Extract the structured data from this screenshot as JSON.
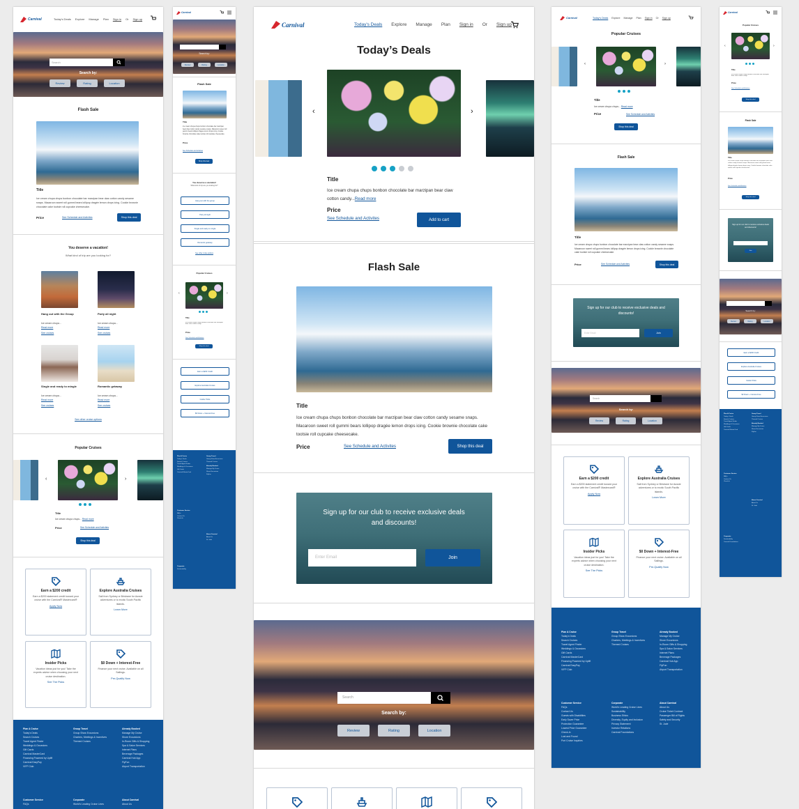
{
  "brand": {
    "logo_text": "Carnival",
    "accent_color": "#10559a",
    "footer_color": "#10559a",
    "dot_color": "#16a1c5"
  },
  "nav": {
    "todays_deals": "Today's Deals",
    "explore": "Explore",
    "manage": "Manage",
    "plan": "Plan",
    "sign_in": "Sign in",
    "or": "Or",
    "sign_up": "Sign up"
  },
  "main": {
    "todays_deals_title": "Today’s Deals",
    "flash_sale_title": "Flash Sale",
    "popular_cruises_title": "Popular Cruises",
    "item_title": "Title",
    "deal_desc_short": "Ice cream chupa chups bonbon chocolate bar marzipan bear claw cotton candy...",
    "deal_read_more": "Read more",
    "flash_desc": "Ice cream chupa chups bonbon chocolate bar marzipan bear claw cotton candy sesame snaps. Macaroon sweet roll gummi bears lollipop dragée lemon drops icing. Cookie brownie chocolate cake tootsie roll cupcake cheesecake.",
    "price_label": "Price",
    "schedule_link": "See Schedule and Activites",
    "add_to_cart": "Add to cart",
    "shop_this_deal": "Shop this deal",
    "signup_title": "Sign up for our club to receive exclusive deals and discounts!",
    "email_placeholder": "Enter Email",
    "join": "Join",
    "search_placeholder": "Search",
    "search_by": "Search by:",
    "filters": [
      "Review",
      "Rating",
      "Location"
    ]
  },
  "vacation": {
    "title": "You deserve a vacation!",
    "subtitle": "What kind of trip are you looking for?",
    "items": [
      {
        "label": "Hang out with the Group",
        "desc": "Ice cream chupa...",
        "read_more": "Read more",
        "see_cruises": "See cruises"
      },
      {
        "label": "Party all night",
        "desc": "Ice cream chupa...",
        "read_more": "Read more",
        "see_cruises": "See cruises"
      },
      {
        "label": "Single and ready to mingle",
        "desc": "Ice cream chupa...",
        "read_more": "Read more",
        "see_cruises": "See cruises"
      },
      {
        "label": "Romantic getaway",
        "desc": "Ice cream chupa...",
        "read_more": "Read more",
        "see_cruises": "See cruises"
      }
    ],
    "see_other": "See other cruise options"
  },
  "promos": [
    {
      "title": "Earn a $200 credit",
      "desc": "Earn a $200 statement credit toward your cruise with the Carnival® Mastercard®",
      "link": "Apply Now",
      "icon": "tag-icon"
    },
    {
      "title": "Explore Australia Cruises",
      "desc": "Sail from Sydney or Brisbane for Aussie adventures or to exotic South Pacific islands.",
      "link": "Learn More",
      "icon": "ship-icon"
    },
    {
      "title": "Insider Picks",
      "desc": "Vacation ideas just for you! Take the experts advice when choosing your next cruise destination.",
      "link": "See The Picks",
      "icon": "map-icon"
    },
    {
      "title": "$0 Down + Interest-Free",
      "desc": "Finance your next cruise. Available on all Sailings.",
      "link": "Pre-Qualify Now",
      "icon": "tag-icon"
    }
  ],
  "footer": {
    "plan_title": "Plan A Cruise",
    "plan_items": [
      "Today's Deals",
      "Search Cruises",
      "Travel Agent Finder",
      "Weddings & Occasions",
      "Gift Cards",
      "Carnival MasterCard",
      "Financing Powered by Uplift",
      "Carnival EasyPay",
      "VIFP Club"
    ],
    "group_title": "Group Travel",
    "group_items": [
      "Group Show Excursions",
      "Charters, Meetings & Incentives",
      "Themed Cruises"
    ],
    "booked_title": "Already Booked",
    "booked_items": [
      "Manage My Cruise",
      "Shore Excursions",
      "In-Room Gifts & Shopping",
      "Spa & Salon Services",
      "Internet Plans",
      "Beverage Packages",
      "Carnival Hub App",
      "FlyFun",
      "Airport Transportation"
    ],
    "service_title": "Customer Service",
    "service_items": [
      "FAQs",
      "Contact Us",
      "Guests with Disabilities",
      "Early Saver Price",
      "Protection Guarantee",
      "Lowest Price Guarantee",
      "Check-In",
      "Lost and Found",
      "Port Cruise Inquiries"
    ],
    "corp_title": "Corporate",
    "corp_items": [
      "World's Leading Cruise Lines",
      "Sustainability",
      "Business Ethics",
      "Diversity, Equity and Inclusion",
      "Privacy Statement",
      "Investor Relations",
      "Carnival Foundations"
    ],
    "about_title": "About Carnival",
    "about_items": [
      "About Us",
      "Cruise Ticket Contract",
      "Passenger Bill of Rights",
      "Safety and Security",
      "St. Jude"
    ]
  },
  "quick_links": [
    "Earn a $200 Credit",
    "Explore Australia Cruises",
    "Insider Picks",
    "$0 Down + Interest-Free"
  ],
  "tablet_vacation": {
    "items": [
      "Hang out with the group",
      "Party all night",
      "Single and ready to mingle",
      "Romantic getaway"
    ],
    "see_other": "See other cruise options"
  }
}
